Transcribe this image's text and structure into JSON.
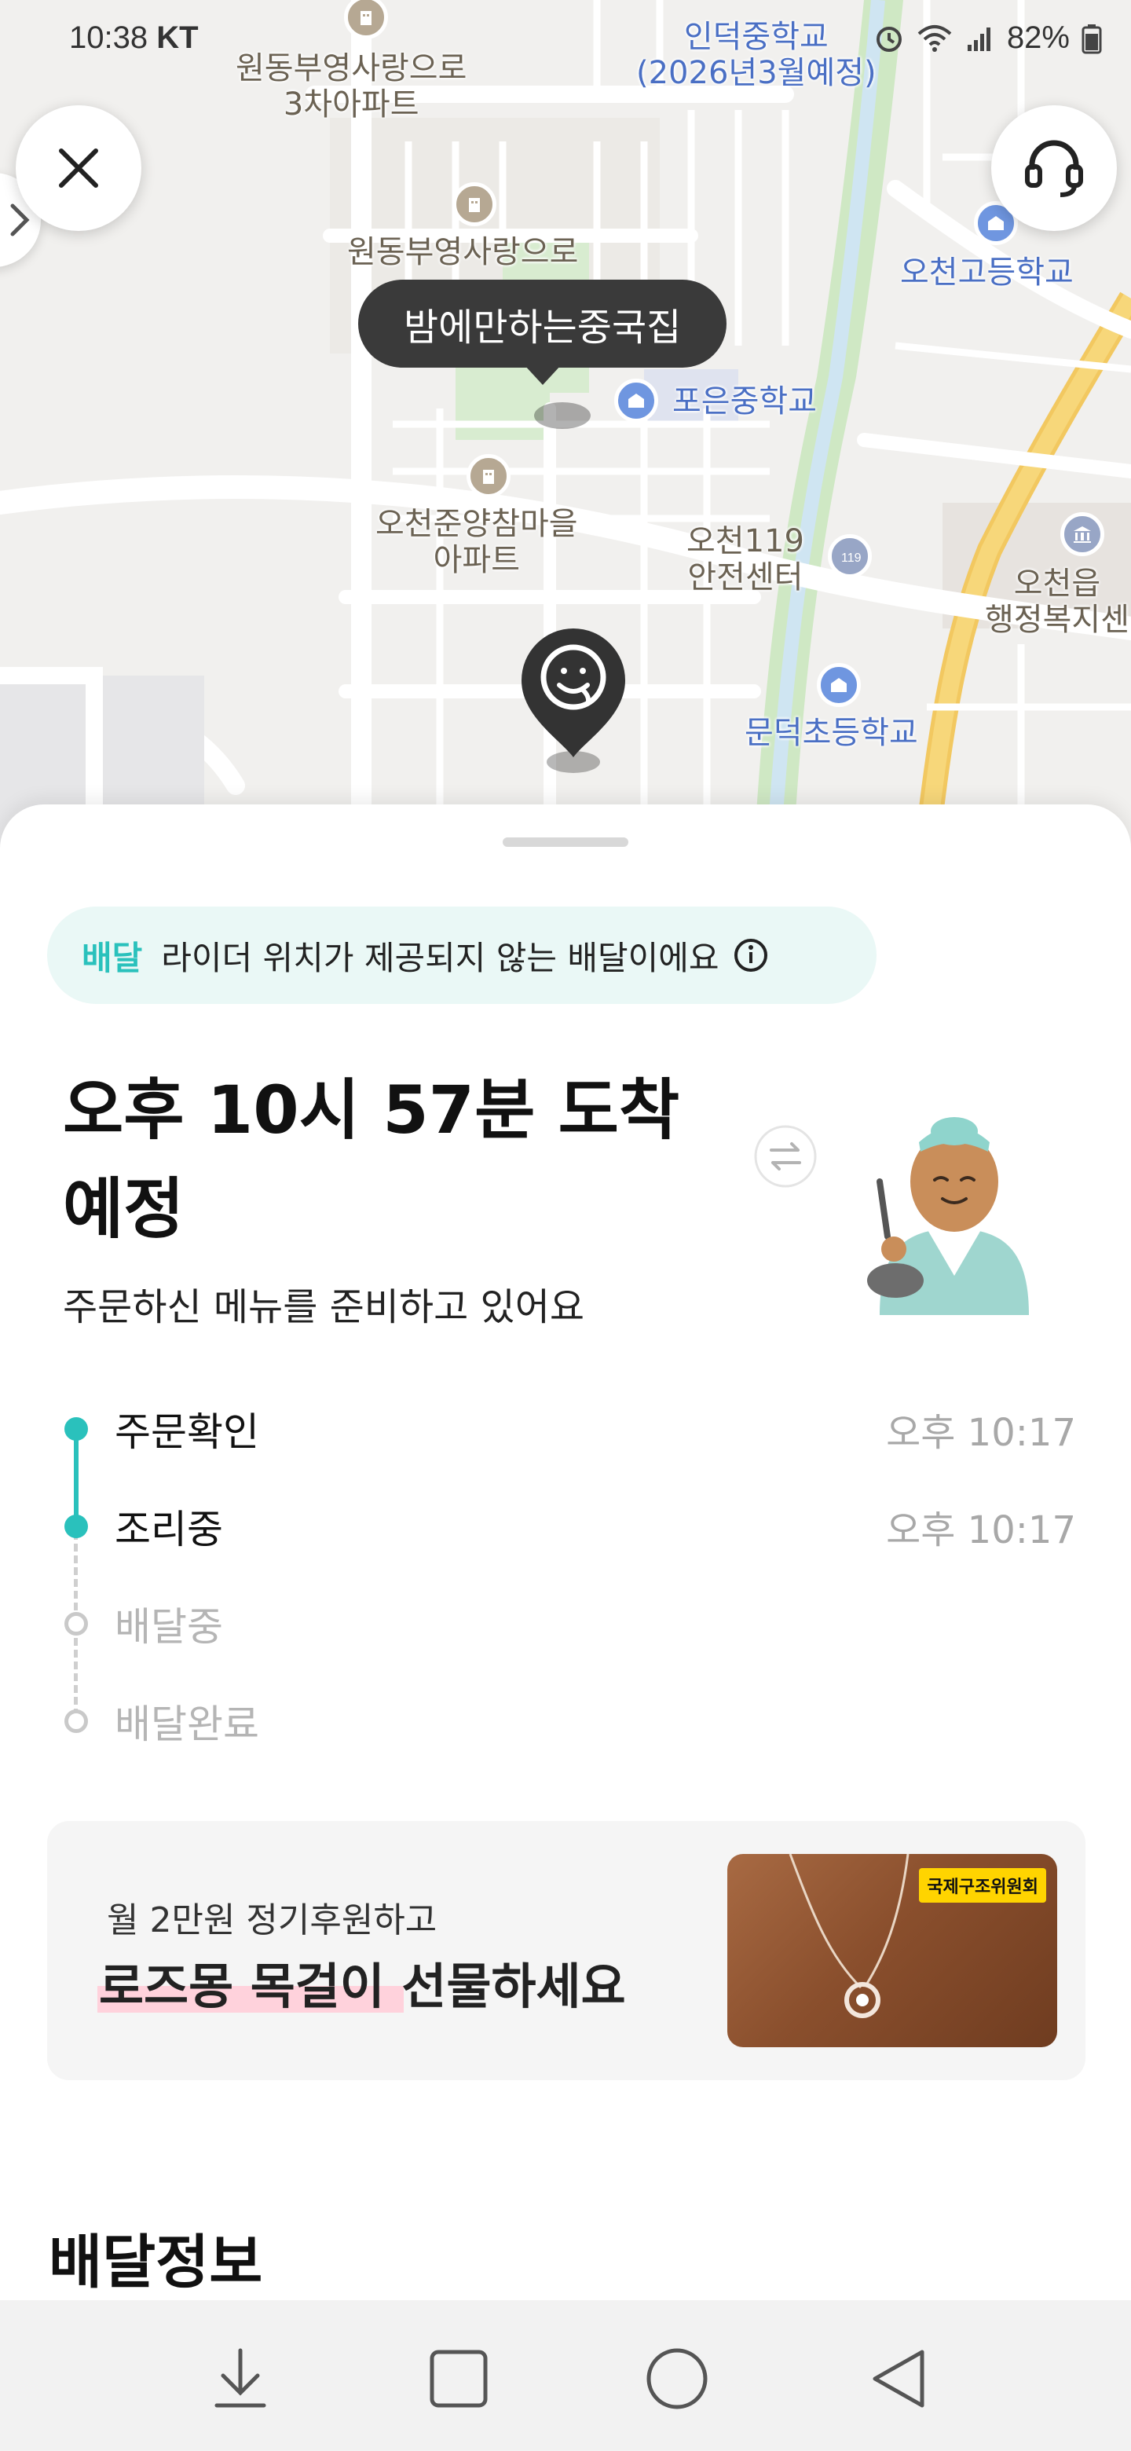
{
  "status_bar": {
    "time": "10:38",
    "carrier": "KT",
    "battery": "82%"
  },
  "map": {
    "store_name": "밤에만하는중국집",
    "labels": {
      "apt1_line1": "원동부영사랑으로",
      "apt1_line2": "3차아파트",
      "apt2": "원동부영사랑으로",
      "apt3_line1": "오천준양참마을",
      "apt3_line2": "아파트",
      "school1_line1": "인덕중학교",
      "school1_line2": "(2026년3월예정)",
      "school2": "오천고등학교",
      "school3": "포은중학교",
      "fire_line1": "오천119",
      "fire_line2": "안전센터",
      "gov_line1": "오천읍",
      "gov_line2": "행정복지센",
      "school4": "문덕초등학교"
    },
    "colors": {
      "park": "#cfe8c4",
      "stream": "#cfe5f2",
      "road_major": "#f7d77a",
      "road": "#ffffff"
    }
  },
  "sheet": {
    "notice": {
      "tag": "배달",
      "text": "라이더 위치가 제공되지 않는 배달이에요"
    },
    "eta_title": "오후 10시 57분 도착 예정",
    "eta_subtitle": "주문하신 메뉴를 준비하고 있어요",
    "steps": [
      {
        "label": "주문확인",
        "time": "오후 10:17",
        "done": true
      },
      {
        "label": "조리중",
        "time": "오후 10:17",
        "done": true
      },
      {
        "label": "배달중",
        "time": "",
        "done": false
      },
      {
        "label": "배달완료",
        "time": "",
        "done": false
      }
    ],
    "banner": {
      "line1": "월 2만원 정기후원하고",
      "line2_highlight": "로즈몽 목걸이",
      "line2_rest": " 선물하세요",
      "org_badge": "국제구조위원회"
    },
    "section_title": "배달정보"
  },
  "accent_color": "#2ac1bc",
  "icons": [
    "close-icon",
    "headset-icon",
    "chevron-right-icon",
    "info-icon",
    "swap-icon",
    "nav-download-icon",
    "nav-square-icon",
    "nav-circle-icon",
    "nav-back-icon"
  ]
}
